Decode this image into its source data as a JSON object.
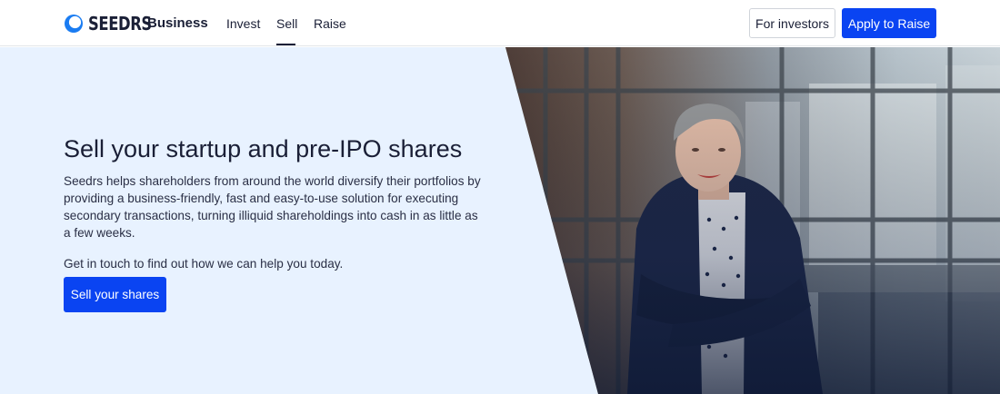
{
  "header": {
    "logo_text": "SEEDRS",
    "business_label": "Business",
    "nav": [
      {
        "label": "Invest",
        "active": false
      },
      {
        "label": "Sell",
        "active": true
      },
      {
        "label": "Raise",
        "active": false
      }
    ],
    "for_investors_label": "For investors",
    "apply_label": "Apply to Raise"
  },
  "hero": {
    "title": "Sell your startup and pre-IPO shares",
    "body": "Seedrs helps shareholders from around the world diversify their portfolios by providing a business-friendly, fast and easy-to-use solution for executing secondary transactions, turning illiquid shareholdings into cash in as little as a few weeks.",
    "cta_text": "Get in touch to find out how we can help you today.",
    "cta_button": "Sell your shares"
  },
  "colors": {
    "accent": "#0a44f2",
    "hero_background": "#e8f2ff",
    "text": "#1a1f36"
  }
}
